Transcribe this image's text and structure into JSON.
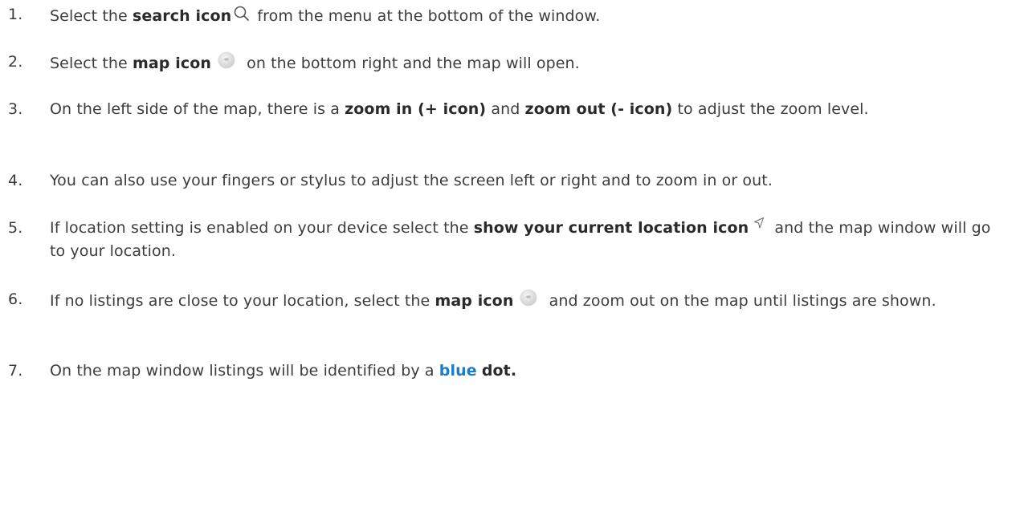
{
  "steps": [
    {
      "number": "1.",
      "text_before": "Select the ",
      "bold": "search icon",
      "text_after": " from the menu at the bottom of the window."
    },
    {
      "number": "2.",
      "text_before": "Select the ",
      "bold": "map icon",
      "text_after": " on the bottom right and the map will open."
    },
    {
      "number": "3.",
      "text_before": "On the left side of the map, there is a ",
      "bold_1": "zoom in (+ icon)",
      "text_middle": " and ",
      "bold_2": "zoom out (- icon)",
      "text_after": " to adjust the zoom level."
    },
    {
      "number": "4.",
      "text": "You can also use your fingers or stylus to adjust the screen left or right and to zoom in or out."
    },
    {
      "number": "5.",
      "text_before": "If location setting is enabled on your device select the ",
      "bold": "show your current location icon",
      "text_after": " and the map window will go to your location."
    },
    {
      "number": "6.",
      "text_before": "If no listings are close to your location, select the ",
      "bold": "map icon",
      "text_after": " and zoom out on the map until listings are shown."
    },
    {
      "number": "7.",
      "text_before": "On the map window listings will be identified by a ",
      "bold_blue": "blue",
      "text_middle": " ",
      "bold": "dot."
    }
  ],
  "icons": {
    "search": "search-icon",
    "map": "map-icon",
    "location": "location-arrow-icon"
  },
  "colors": {
    "text": "#3c3c3c",
    "highlight_blue": "#1c7cc4"
  }
}
